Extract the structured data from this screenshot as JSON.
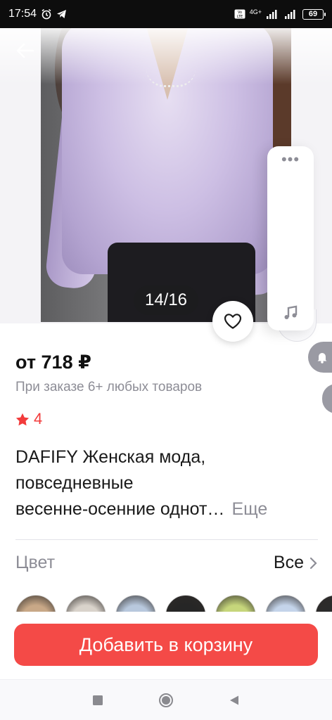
{
  "status_bar": {
    "time": "17:54",
    "battery": "69",
    "network": "4G+"
  },
  "gallery": {
    "counter": "14/16"
  },
  "product": {
    "price": "от 718 ₽",
    "price_note": "При заказе 6+ любых товаров",
    "rating": "4",
    "title_lines": [
      "DAFIFY Женская мода,",
      "повседневные",
      "весенне-осенние однот…"
    ],
    "more_label": "Еще"
  },
  "color_section": {
    "label": "Цвет",
    "all_label": "Все",
    "swatch_colors": [
      "#c8a887",
      "#d9d3cb",
      "#b8c8dd",
      "#262626",
      "#c6d67b",
      "#c4d4ea",
      "#2b2b2b"
    ]
  },
  "actions": {
    "add_to_cart": "Добавить в корзину"
  },
  "colors": {
    "accent": "#f44a47",
    "star": "#f23b3b",
    "muted_text": "#8d8d96"
  },
  "icons": [
    "back-arrow-icon",
    "heart-icon",
    "more-dots-icon",
    "music-note-icon",
    "star-icon",
    "chevron-right-icon",
    "nav-square-icon",
    "nav-circle-icon",
    "nav-back-triangle-icon"
  ]
}
